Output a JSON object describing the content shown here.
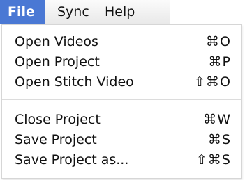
{
  "menubar": {
    "items": [
      {
        "label": "File"
      },
      {
        "label": "Sync"
      },
      {
        "label": "Help"
      }
    ]
  },
  "file_menu": {
    "items": [
      {
        "label": "Open Videos",
        "shortcut": "⌘O"
      },
      {
        "label": "Open Project",
        "shortcut": "⌘P"
      },
      {
        "label": "Open Stitch Video",
        "shortcut": "⇧⌘O"
      },
      {
        "label": "Close Project",
        "shortcut": "⌘W"
      },
      {
        "label": "Save Project",
        "shortcut": "⌘S"
      },
      {
        "label": "Save Project as...",
        "shortcut": "⇧⌘S"
      }
    ]
  },
  "colors": {
    "active_menu_bg": "#4a78d4",
    "active_menu_text": "#ffffff"
  }
}
